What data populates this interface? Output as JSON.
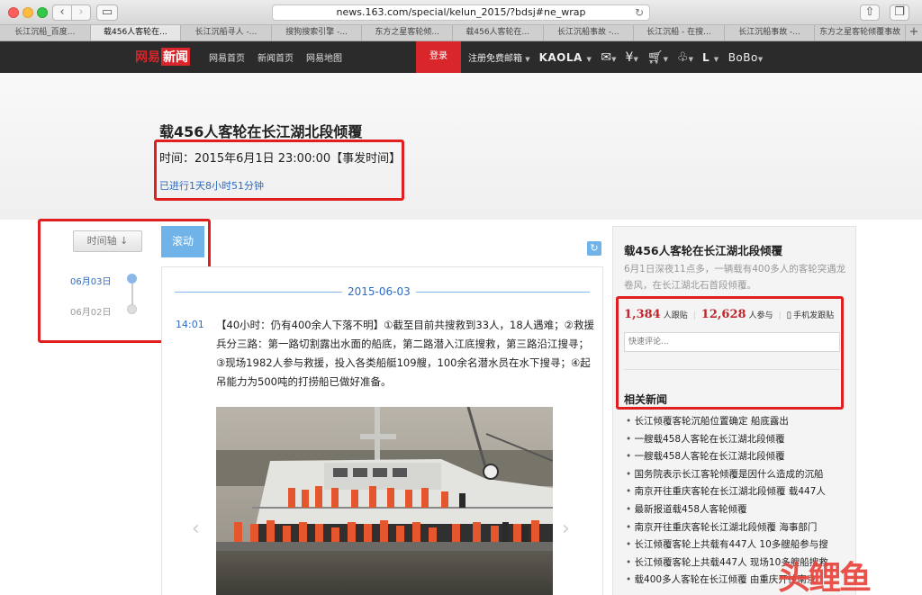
{
  "browser": {
    "url": "news.163.com/special/kelun_2015/?bdsj#ne_wrap",
    "tabs": [
      "长江沉船_百度...",
      "载456人客轮在...",
      "长江沉船寻人 -...",
      "搜狗搜索引擎 -...",
      "东方之星客轮倾...",
      "载456人客轮在...",
      "长江沉船事故 -...",
      "长江沉船 - 在搜...",
      "长江沉船事故 -...",
      "东方之星客轮倾覆事故"
    ],
    "active_tab": 1
  },
  "topbar": {
    "logo_part1": "网易",
    "logo_part2": "新闻",
    "links": [
      "网易首页",
      "新闻首页",
      "网易地图"
    ],
    "login": "登录",
    "register": "注册免费邮箱",
    "kaola": "KAOLA",
    "user_initial": "L",
    "bobo": "BoBo"
  },
  "header": {
    "title": "载456人客轮在长江湖北段倾覆",
    "event_time": "时间：2015年6月1日 23:00:00【事发时间】",
    "elapsed": "已进行1天8小时51分钟"
  },
  "timeline": {
    "button": "时间轴 ↓",
    "scroll_button": "滚动",
    "dates": [
      "06月03日",
      "06月02日"
    ]
  },
  "feed": {
    "day": "2015-06-03",
    "entry_time": "14:01",
    "entry_text": "【40小时：仍有400余人下落不明】①截至目前共搜救到33人，18人遇难；②救援兵分三路：第一路切割露出水面的船底，第二路潜入江底搜救，第三路沿江搜寻；③现场1982人参与救援，投入各类船艇109艘，100余名潜水员在水下搜寻；④起吊能力为500吨的打捞船已做好准备。"
  },
  "right": {
    "title": "载456人客轮在长江湖北段倾覆",
    "desc": "6月1日深夜11点多，一辆载有400多人的客轮突遇龙卷风，在长江湖北石首段倾覆。",
    "followers": "1,384",
    "followers_label": "人跟贴",
    "participants": "12,628",
    "participants_label": "人参与",
    "phone_post": "手机发跟贴",
    "comment_placeholder": "快速评论...",
    "related_title": "相关新闻",
    "related": [
      "长江倾覆客轮沉船位置确定 船底露出",
      "一艘载458人客轮在长江湖北段倾覆",
      "一艘载458人客轮在长江湖北段倾覆",
      "国务院表示长江客轮倾覆是因什么造成的沉船",
      "南京开往重庆客轮在长江湖北段倾覆 载447人",
      "最新报道载458人客轮倾覆",
      "南京开往重庆客轮长江湖北段倾覆 海事部门",
      "长江倾覆客轮上共载有447人 10多艘船参与搜",
      "长江倾覆客轮上共载447人 现场10多艘船搜救",
      "载400多人客轮在长江倾覆 由重庆开往南京"
    ]
  },
  "watermark": "头鲤鱼"
}
